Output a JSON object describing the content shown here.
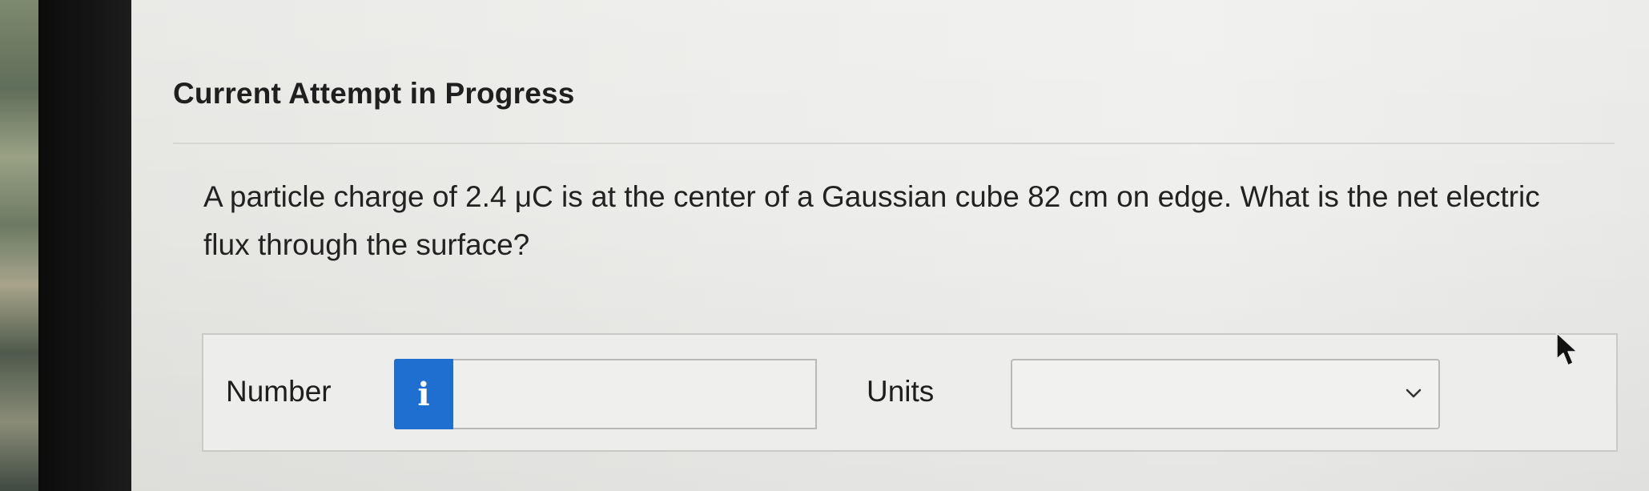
{
  "page": {
    "heading": "Current Attempt in Progress",
    "question": "A particle charge of 2.4 μC is at the center of a Gaussian cube 82 cm on edge. What is the net electric flux through the surface?"
  },
  "answer": {
    "number_label": "Number",
    "info_glyph": "i",
    "number_value": "",
    "units_label": "Units",
    "units_value": ""
  },
  "icons": {
    "info": "info-icon",
    "dropdown": "chevron-down-icon",
    "cursor": "mouse-pointer-icon"
  },
  "colors": {
    "accent": "#1f6fd1",
    "text": "#222222",
    "border": "#b9b9b6"
  }
}
